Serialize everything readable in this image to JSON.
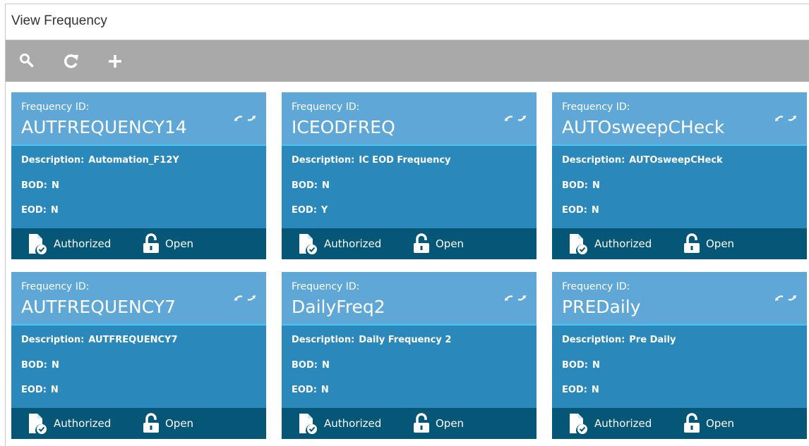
{
  "page": {
    "title": "View Frequency"
  },
  "toolbar": {
    "buttons": [
      {
        "name": "search-button",
        "icon": "search-icon"
      },
      {
        "name": "refresh-button",
        "icon": "refresh-icon"
      },
      {
        "name": "add-button",
        "icon": "plus-icon"
      }
    ]
  },
  "labels": {
    "frequency_id": "Frequency ID:",
    "description": "Description:",
    "bod": "BOD:",
    "eod": "EOD:"
  },
  "cards": [
    {
      "id": "AUTFREQUENCY14",
      "description": "Automation_F12Y",
      "bod": "N",
      "eod": "N",
      "auth_status": "Authorized",
      "record_status": "Open"
    },
    {
      "id": "ICEODFREQ",
      "description": "IC EOD Frequency",
      "bod": "N",
      "eod": "Y",
      "auth_status": "Authorized",
      "record_status": "Open"
    },
    {
      "id": "AUTOsweepCHeck",
      "description": "AUTOsweepCHeck",
      "bod": "N",
      "eod": "N",
      "auth_status": "Authorized",
      "record_status": "Open"
    },
    {
      "id": "AUTFREQUENCY7",
      "description": "AUTFREQUENCY7",
      "bod": "N",
      "eod": "N",
      "auth_status": "Authorized",
      "record_status": "Open"
    },
    {
      "id": "DailyFreq2",
      "description": "Daily Frequency 2",
      "bod": "N",
      "eod": "N",
      "auth_status": "Authorized",
      "record_status": "Open"
    },
    {
      "id": "PREDaily",
      "description": "Pre Daily",
      "bod": "N",
      "eod": "N",
      "auth_status": "Authorized",
      "record_status": "Open"
    }
  ],
  "colors": {
    "toolbar": "#a9a9a9",
    "card_header": "#5fa7d6",
    "card_body": "#2a88bb",
    "card_footer": "#055677",
    "header_divider": "#47c5f4"
  }
}
